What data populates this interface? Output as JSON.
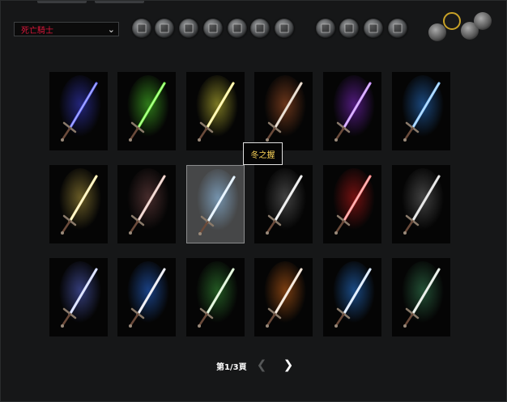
{
  "class_select": {
    "value": "死亡騎士"
  },
  "armor_slots": [
    {
      "icon": "helmet-icon"
    },
    {
      "icon": "shoulders-icon"
    },
    {
      "icon": "cloak-icon"
    },
    {
      "icon": "chest-icon"
    },
    {
      "icon": "shirt-icon"
    },
    {
      "icon": "tabard-icon"
    },
    {
      "icon": "bracers-icon"
    },
    {
      "icon": "gloves-icon"
    },
    {
      "icon": "belt-icon"
    },
    {
      "icon": "legs-icon"
    },
    {
      "icon": "boots-icon"
    }
  ],
  "weapon_categories": [
    {
      "icon": "sword-icon"
    },
    {
      "icon": "axe-icon",
      "selected": true
    },
    {
      "icon": "shield-icon"
    },
    {
      "icon": "mace-icon"
    }
  ],
  "appearances": [
    {
      "glow": "#3b3fd8",
      "blade": "#6a70ff"
    },
    {
      "glow": "#4fd62a",
      "blade": "#7dff4c"
    },
    {
      "glow": "#d8d23a",
      "blade": "#fff49a"
    },
    {
      "glow": "#b85a2a",
      "blade": "#e0d0c0"
    },
    {
      "glow": "#8a2ad8",
      "blade": "#c890ff"
    },
    {
      "glow": "#2a7ad8",
      "blade": "#8cc8ff"
    },
    {
      "glow": "#b8a040",
      "blade": "#fff0b0"
    },
    {
      "glow": "#7a4a4a",
      "blade": "#e8c8c0"
    },
    {
      "glow": "#9ad0ff",
      "blade": "#e0f0ff",
      "selected": true
    },
    {
      "glow": "#707070",
      "blade": "#e8e8e8"
    },
    {
      "glow": "#c81a1a",
      "blade": "#ff8a8a"
    },
    {
      "glow": "#707070",
      "blade": "#dcdcdc"
    },
    {
      "glow": "#5a6ad8",
      "blade": "#d0d8ff"
    },
    {
      "glow": "#2a70e8",
      "blade": "#e8e8f0"
    },
    {
      "glow": "#3a9a3a",
      "blade": "#d8f0d0"
    },
    {
      "glow": "#d86a1a",
      "blade": "#f0e0d0"
    },
    {
      "glow": "#2a80e8",
      "blade": "#d8e8ff"
    },
    {
      "glow": "#3a8a5a",
      "blade": "#e0e8e0"
    }
  ],
  "tooltip": {
    "text": "冬之握"
  },
  "pagination": {
    "label": "第1/3頁",
    "prev_icon": "chevron-left-icon",
    "next_icon": "chevron-right-icon"
  }
}
